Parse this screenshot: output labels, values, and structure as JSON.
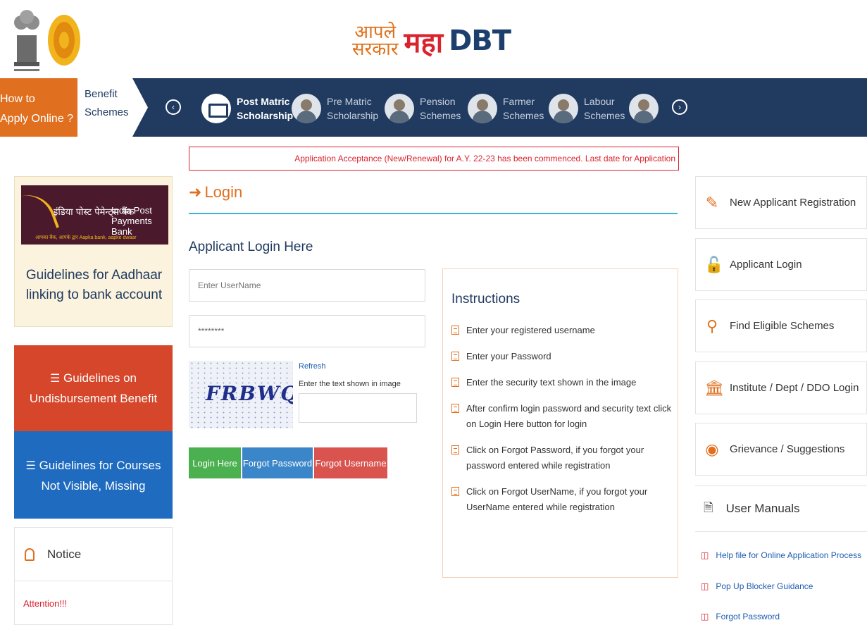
{
  "header": {
    "brand_aaple_line1": "आपले",
    "brand_aaple_line2": "सरकार",
    "brand_maha": "महा",
    "brand_dbt": "DBT"
  },
  "nav": {
    "howto_line1": "How to",
    "howto_line2": "Apply Online ?",
    "benefit_line1": "Benefit",
    "benefit_line2": "Schemes",
    "items": [
      {
        "line1": "Post Matric",
        "line2": "Scholarship"
      },
      {
        "line1": "Pre Matric",
        "line2": "Scholarship"
      },
      {
        "line1": "Pension",
        "line2": "Schemes"
      },
      {
        "line1": "Farmer",
        "line2": "Schemes"
      },
      {
        "line1": "Labour",
        "line2": "Schemes"
      }
    ]
  },
  "left": {
    "ippb_hindi": "इंडिया पोस्ट पेमेन्ट्स बैंक",
    "ippb_english": "India Post Payments Bank",
    "ippb_tagline": "आपका बैंक, आपके द्वार   Aapka bank, aapke dwaar",
    "aadhaar_guidelines": "Guidelines for Aadhaar linking to bank account",
    "undisbursement": "Guidelines on Undisbursement Benefit",
    "courses": "Guidelines for Courses Not Visible, Missing",
    "notice_title": "Notice",
    "notice_attention": "Attention!!!"
  },
  "marquee": "Application Acceptance (New/Renewal) for A.Y. 22-23 has been commenced. Last date for Application",
  "login": {
    "title": "Login",
    "subtitle": "Applicant Login Here",
    "username_placeholder": "Enter UserName",
    "password_value": "********",
    "captcha_text": "FRBWQ",
    "refresh": "Refresh",
    "captcha_help": "Enter the text shown in image",
    "btn_login": "Login Here",
    "btn_forgot_password": "Forgot Password",
    "btn_forgot_username": "Forgot Username"
  },
  "instructions": {
    "title": "Instructions",
    "items": [
      "Enter your registered username",
      "Enter your Password",
      "Enter the security text shown in the image",
      "After confirm login password and security text click on Login Here button for login",
      "Click on Forgot Password, if you forgot your password entered while registration",
      "Click on Forgot UserName, if you forgot your UserName entered while registration"
    ]
  },
  "right": {
    "new_registration": "New Applicant Registration",
    "applicant_login": "Applicant Login",
    "find_schemes": "Find Eligible Schemes",
    "institute_login": "Institute / Dept / DDO Login",
    "grievance": "Grievance / Suggestions",
    "user_manuals": "User Manuals",
    "manual_links": [
      "Help file for Online Application Process",
      "Pop Up Blocker Guidance",
      "Forgot Password"
    ]
  },
  "colors": {
    "navy": "#203a60",
    "orange": "#e07020",
    "red": "#d9232e",
    "green": "#4bb04f",
    "blue": "#3b86c8"
  }
}
